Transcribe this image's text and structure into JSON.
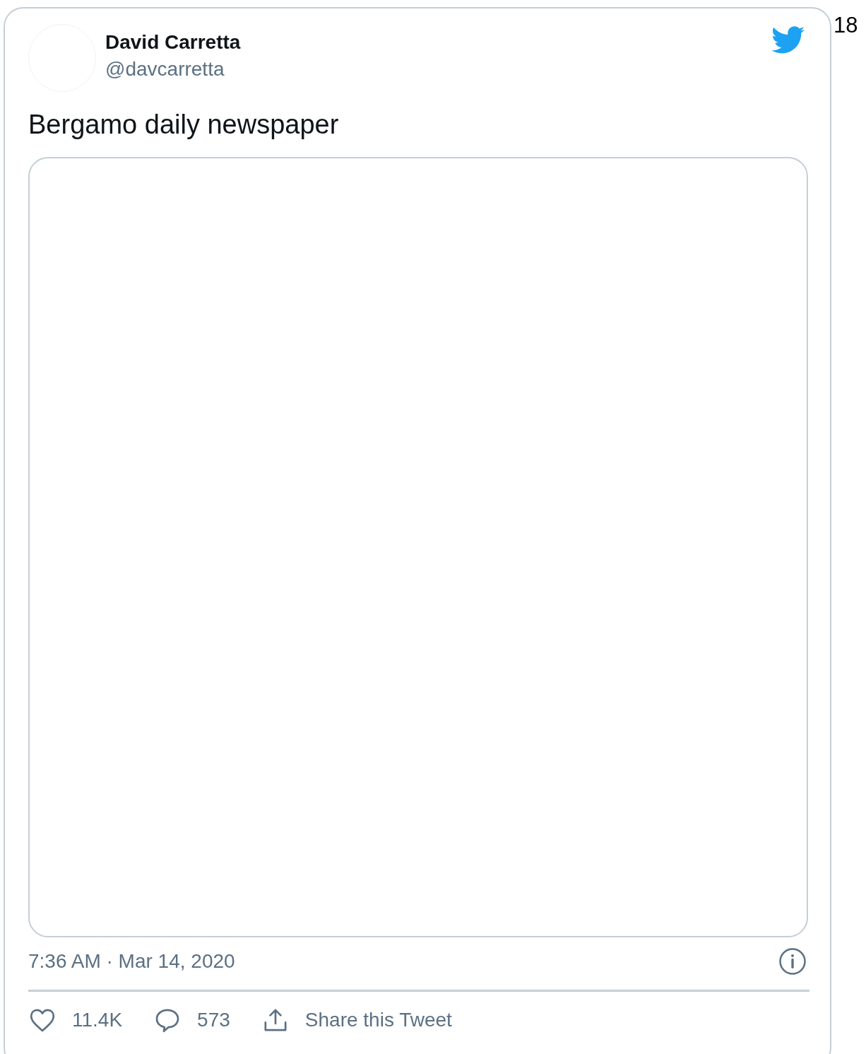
{
  "author": {
    "name": "David Carretta",
    "handle": "@davcarretta"
  },
  "text": "Bergamo daily newspaper",
  "timestamp": "7:36 AM · Mar 14, 2020",
  "actions": [
    {
      "kind": "like",
      "label": "11.4K"
    },
    {
      "kind": "reply",
      "label": "573"
    },
    {
      "kind": "share",
      "label": "Share this Tweet"
    }
  ],
  "side_number": "18"
}
